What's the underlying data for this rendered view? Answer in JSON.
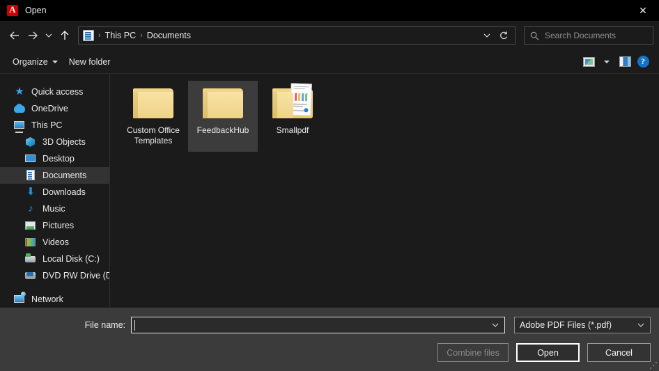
{
  "titlebar": {
    "app_icon": "adobe-acrobat-icon",
    "title": "Open",
    "close_label": "✕"
  },
  "nav": {
    "back_label": "←",
    "forward_label": "→",
    "recent_label": "∨",
    "up_label": "↑",
    "breadcrumbs": [
      "This PC",
      "Documents"
    ],
    "separator": "›",
    "dropdown_label": "∨",
    "refresh_label": "↻"
  },
  "search": {
    "placeholder": "Search Documents",
    "icon": "search-icon"
  },
  "toolbar": {
    "organize_label": "Organize",
    "new_folder_label": "New folder",
    "view_icon": "view-options-icon",
    "view_dropdown_label": "▾",
    "preview_pane_icon": "preview-pane-icon",
    "help_label": "?"
  },
  "sidebar": {
    "items": [
      {
        "label": "Quick access",
        "icon": "star-icon",
        "indent": false,
        "selected": false
      },
      {
        "label": "OneDrive",
        "icon": "cloud-icon",
        "indent": false,
        "selected": false
      },
      {
        "label": "This PC",
        "icon": "computer-icon",
        "indent": false,
        "selected": false
      },
      {
        "label": "3D Objects",
        "icon": "cube-icon",
        "indent": true,
        "selected": false
      },
      {
        "label": "Desktop",
        "icon": "desktop-icon",
        "indent": true,
        "selected": false
      },
      {
        "label": "Documents",
        "icon": "documents-icon",
        "indent": true,
        "selected": true
      },
      {
        "label": "Downloads",
        "icon": "download-icon",
        "indent": true,
        "selected": false
      },
      {
        "label": "Music",
        "icon": "music-icon",
        "indent": true,
        "selected": false
      },
      {
        "label": "Pictures",
        "icon": "pictures-icon",
        "indent": true,
        "selected": false
      },
      {
        "label": "Videos",
        "icon": "videos-icon",
        "indent": true,
        "selected": false
      },
      {
        "label": "Local Disk (C:)",
        "icon": "hard-disk-icon",
        "indent": true,
        "selected": false
      },
      {
        "label": "DVD RW Drive (D:) D",
        "icon": "dvd-drive-icon",
        "indent": true,
        "selected": false
      },
      {
        "label": "Network",
        "icon": "network-icon",
        "indent": false,
        "selected": false
      }
    ],
    "download_glyph": "⬇",
    "music_glyph": "♪",
    "star_glyph": "★"
  },
  "files": {
    "items": [
      {
        "name": "Custom Office Templates",
        "type": "folder",
        "selected": false,
        "has_preview": false
      },
      {
        "name": "FeedbackHub",
        "type": "folder",
        "selected": true,
        "has_preview": false
      },
      {
        "name": "Smallpdf",
        "type": "folder",
        "selected": false,
        "has_preview": true
      }
    ]
  },
  "bottom": {
    "filename_label": "File name:",
    "filename_value": "",
    "filename_dropdown_label": "∨",
    "filetype_value": "Adobe PDF Files (*.pdf)",
    "filetype_dropdown_label": "∨",
    "combine_label": "Combine files",
    "open_label": "Open",
    "cancel_label": "Cancel"
  },
  "colors": {
    "accent_blue": "#1373c4",
    "folder_yellow": "#f0d184",
    "selection_gray": "#3c3c3c",
    "panel_gray": "#3b3b3b",
    "window_dark": "#1b1b1b",
    "adobe_red": "#cc0000"
  }
}
